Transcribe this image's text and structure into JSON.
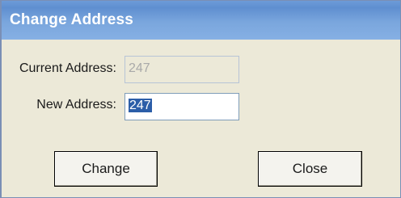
{
  "window": {
    "title": "Change Address"
  },
  "form": {
    "current_address_label": "Current Address:",
    "current_address_value": "247",
    "new_address_label": "New Address:",
    "new_address_value": "247"
  },
  "buttons": {
    "change_label": "Change",
    "close_label": "Close"
  },
  "colors": {
    "title_bar": "#7aa6dd",
    "dialog_background": "#ece9d8",
    "selection_highlight": "#2c5ea8"
  }
}
